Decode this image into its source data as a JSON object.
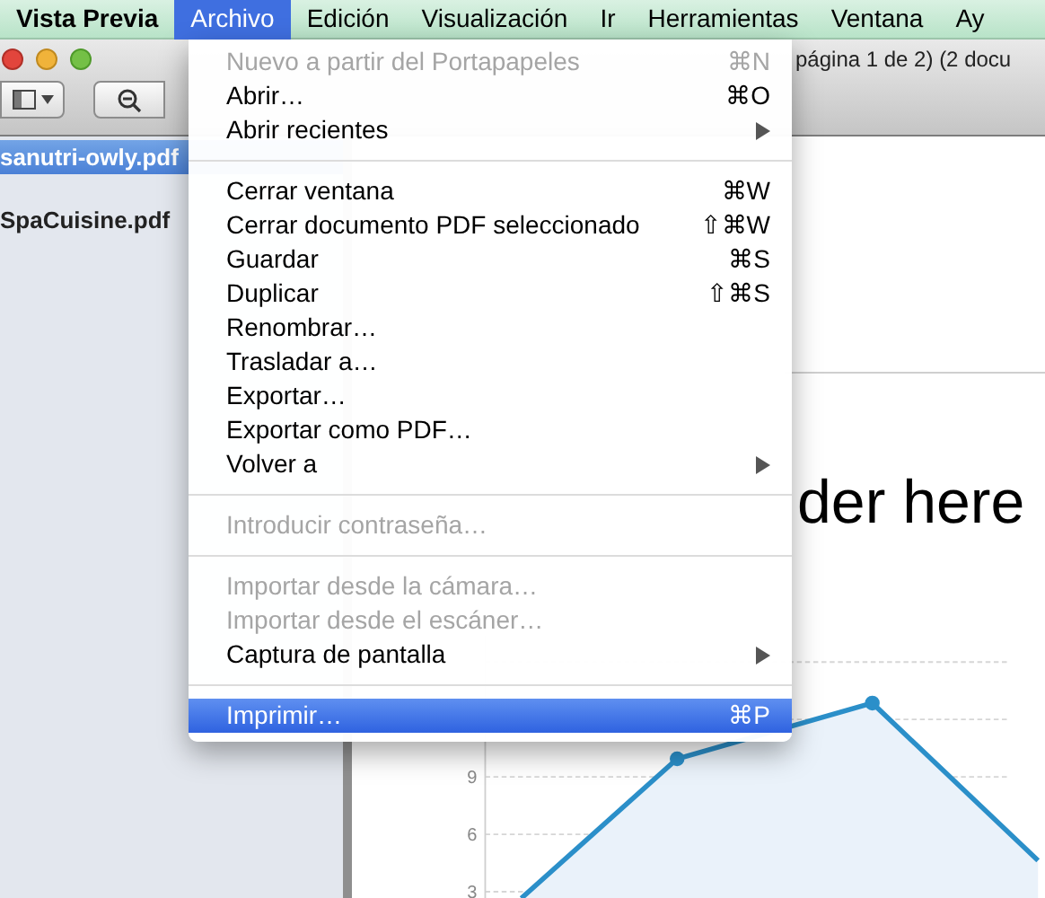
{
  "menubar": {
    "items": [
      {
        "label": "Vista Previa",
        "kind": "app",
        "selected": false
      },
      {
        "label": "Archivo",
        "kind": "menu",
        "selected": true
      },
      {
        "label": "Edición",
        "kind": "menu",
        "selected": false
      },
      {
        "label": "Visualización",
        "kind": "menu",
        "selected": false
      },
      {
        "label": "Ir",
        "kind": "menu",
        "selected": false
      },
      {
        "label": "Herramientas",
        "kind": "menu",
        "selected": false
      },
      {
        "label": "Ventana",
        "kind": "menu",
        "selected": false
      },
      {
        "label": "Ay",
        "kind": "menu",
        "selected": false
      }
    ]
  },
  "window": {
    "title": "página 1 de 2) (2 docu"
  },
  "sidebar": {
    "items": [
      {
        "label": "sanutri-owly.pdf",
        "selected": true
      },
      {
        "label": "SpaCuisine.pdf",
        "selected": false
      }
    ]
  },
  "document": {
    "header": "der here",
    "chart_axis_labels": [
      "9",
      "6",
      "3"
    ]
  },
  "file_menu": {
    "items": [
      {
        "kind": "item",
        "label": "Nuevo a partir del Portapapeles",
        "shortcut": "⌘N",
        "submenu": false,
        "disabled": true,
        "selected": false
      },
      {
        "kind": "item",
        "label": "Abrir…",
        "shortcut": "⌘O",
        "submenu": false,
        "disabled": false,
        "selected": false
      },
      {
        "kind": "item",
        "label": "Abrir recientes",
        "submenu": true,
        "disabled": false,
        "selected": false
      },
      {
        "kind": "separator"
      },
      {
        "kind": "item",
        "label": "Cerrar ventana",
        "shortcut": "⌘W",
        "submenu": false,
        "disabled": false,
        "selected": false
      },
      {
        "kind": "item",
        "label": "Cerrar documento PDF seleccionado",
        "shortcut": "⇧⌘W",
        "submenu": false,
        "disabled": false,
        "selected": false
      },
      {
        "kind": "item",
        "label": "Guardar",
        "shortcut": "⌘S",
        "submenu": false,
        "disabled": false,
        "selected": false
      },
      {
        "kind": "item",
        "label": "Duplicar",
        "shortcut": "⇧⌘S",
        "submenu": false,
        "disabled": false,
        "selected": false
      },
      {
        "kind": "item",
        "label": "Renombrar…",
        "submenu": false,
        "disabled": false,
        "selected": false
      },
      {
        "kind": "item",
        "label": "Trasladar a…",
        "submenu": false,
        "disabled": false,
        "selected": false
      },
      {
        "kind": "item",
        "label": "Exportar…",
        "submenu": false,
        "disabled": false,
        "selected": false
      },
      {
        "kind": "item",
        "label": "Exportar como PDF…",
        "submenu": false,
        "disabled": false,
        "selected": false
      },
      {
        "kind": "item",
        "label": "Volver a",
        "submenu": true,
        "disabled": false,
        "selected": false
      },
      {
        "kind": "separator"
      },
      {
        "kind": "item",
        "label": "Introducir contraseña…",
        "submenu": false,
        "disabled": true,
        "selected": false
      },
      {
        "kind": "separator"
      },
      {
        "kind": "item",
        "label": "Importar desde la cámara…",
        "submenu": false,
        "disabled": true,
        "selected": false
      },
      {
        "kind": "item",
        "label": "Importar desde el escáner…",
        "submenu": false,
        "disabled": true,
        "selected": false
      },
      {
        "kind": "item",
        "label": "Captura de pantalla",
        "submenu": true,
        "disabled": false,
        "selected": false
      },
      {
        "kind": "separator"
      },
      {
        "kind": "item",
        "label": "Imprimir…",
        "shortcut": "⌘P",
        "submenu": false,
        "disabled": false,
        "selected": true
      }
    ]
  }
}
